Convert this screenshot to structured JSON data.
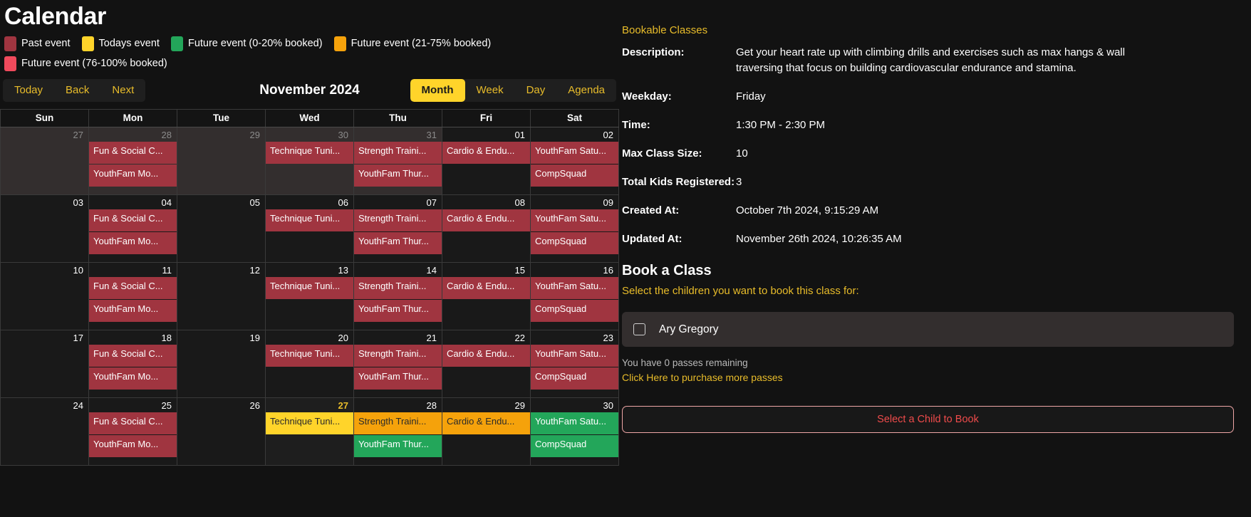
{
  "page": {
    "title": "Calendar"
  },
  "legend": {
    "items": [
      {
        "label": "Past event",
        "color": "#a03540"
      },
      {
        "label": "Todays event",
        "color": "#ffd42a"
      },
      {
        "label": "Future event (0-20% booked)",
        "color": "#23a65a"
      },
      {
        "label": "Future event (21-75% booked)",
        "color": "#f5a20b"
      },
      {
        "label": "Future event (76-100% booked)",
        "color": "#f04a5c"
      }
    ]
  },
  "toolbar": {
    "nav": [
      "Today",
      "Back",
      "Next"
    ],
    "label": "November 2024",
    "views": [
      {
        "label": "Month",
        "active": true
      },
      {
        "label": "Week",
        "active": false
      },
      {
        "label": "Day",
        "active": false
      },
      {
        "label": "Agenda",
        "active": false
      }
    ]
  },
  "calendar": {
    "weekdays": [
      "Sun",
      "Mon",
      "Tue",
      "Wed",
      "Thu",
      "Fri",
      "Sat"
    ],
    "weeks": [
      [
        {
          "num": "27",
          "off": true,
          "today": false,
          "events": []
        },
        {
          "num": "28",
          "off": true,
          "today": false,
          "events": [
            {
              "title": "Fun & Social C...",
              "state": "past"
            },
            {
              "title": "YouthFam Mo...",
              "state": "past"
            }
          ]
        },
        {
          "num": "29",
          "off": true,
          "today": false,
          "events": []
        },
        {
          "num": "30",
          "off": true,
          "today": false,
          "events": [
            {
              "title": "Technique Tuni...",
              "state": "past"
            }
          ]
        },
        {
          "num": "31",
          "off": true,
          "today": false,
          "events": [
            {
              "title": "Strength Traini...",
              "state": "past"
            },
            {
              "title": "YouthFam Thur...",
              "state": "past"
            }
          ]
        },
        {
          "num": "01",
          "off": false,
          "today": false,
          "events": [
            {
              "title": "Cardio & Endu...",
              "state": "past"
            }
          ]
        },
        {
          "num": "02",
          "off": false,
          "today": false,
          "events": [
            {
              "title": "YouthFam Satu...",
              "state": "past"
            },
            {
              "title": "CompSquad",
              "state": "past"
            }
          ]
        }
      ],
      [
        {
          "num": "03",
          "off": false,
          "today": false,
          "events": []
        },
        {
          "num": "04",
          "off": false,
          "today": false,
          "events": [
            {
              "title": "Fun & Social C...",
              "state": "past"
            },
            {
              "title": "YouthFam Mo...",
              "state": "past"
            }
          ]
        },
        {
          "num": "05",
          "off": false,
          "today": false,
          "events": []
        },
        {
          "num": "06",
          "off": false,
          "today": false,
          "events": [
            {
              "title": "Technique Tuni...",
              "state": "past"
            }
          ]
        },
        {
          "num": "07",
          "off": false,
          "today": false,
          "events": [
            {
              "title": "Strength Traini...",
              "state": "past"
            },
            {
              "title": "YouthFam Thur...",
              "state": "past"
            }
          ]
        },
        {
          "num": "08",
          "off": false,
          "today": false,
          "events": [
            {
              "title": "Cardio & Endu...",
              "state": "past"
            }
          ]
        },
        {
          "num": "09",
          "off": false,
          "today": false,
          "events": [
            {
              "title": "YouthFam Satu...",
              "state": "past"
            },
            {
              "title": "CompSquad",
              "state": "past"
            }
          ]
        }
      ],
      [
        {
          "num": "10",
          "off": false,
          "today": false,
          "events": []
        },
        {
          "num": "11",
          "off": false,
          "today": false,
          "events": [
            {
              "title": "Fun & Social C...",
              "state": "past"
            },
            {
              "title": "YouthFam Mo...",
              "state": "past"
            }
          ]
        },
        {
          "num": "12",
          "off": false,
          "today": false,
          "events": []
        },
        {
          "num": "13",
          "off": false,
          "today": false,
          "events": [
            {
              "title": "Technique Tuni...",
              "state": "past"
            }
          ]
        },
        {
          "num": "14",
          "off": false,
          "today": false,
          "events": [
            {
              "title": "Strength Traini...",
              "state": "past"
            },
            {
              "title": "YouthFam Thur...",
              "state": "past"
            }
          ]
        },
        {
          "num": "15",
          "off": false,
          "today": false,
          "events": [
            {
              "title": "Cardio & Endu...",
              "state": "past"
            }
          ]
        },
        {
          "num": "16",
          "off": false,
          "today": false,
          "events": [
            {
              "title": "YouthFam Satu...",
              "state": "past"
            },
            {
              "title": "CompSquad",
              "state": "past"
            }
          ]
        }
      ],
      [
        {
          "num": "17",
          "off": false,
          "today": false,
          "events": []
        },
        {
          "num": "18",
          "off": false,
          "today": false,
          "events": [
            {
              "title": "Fun & Social C...",
              "state": "past"
            },
            {
              "title": "YouthFam Mo...",
              "state": "past"
            }
          ]
        },
        {
          "num": "19",
          "off": false,
          "today": false,
          "events": []
        },
        {
          "num": "20",
          "off": false,
          "today": false,
          "events": [
            {
              "title": "Technique Tuni...",
              "state": "past"
            }
          ]
        },
        {
          "num": "21",
          "off": false,
          "today": false,
          "events": [
            {
              "title": "Strength Traini...",
              "state": "past"
            },
            {
              "title": "YouthFam Thur...",
              "state": "past"
            }
          ]
        },
        {
          "num": "22",
          "off": false,
          "today": false,
          "events": [
            {
              "title": "Cardio & Endu...",
              "state": "past"
            }
          ]
        },
        {
          "num": "23",
          "off": false,
          "today": false,
          "events": [
            {
              "title": "YouthFam Satu...",
              "state": "past"
            },
            {
              "title": "CompSquad",
              "state": "past"
            }
          ]
        }
      ],
      [
        {
          "num": "24",
          "off": false,
          "today": false,
          "events": []
        },
        {
          "num": "25",
          "off": false,
          "today": false,
          "events": [
            {
              "title": "Fun & Social C...",
              "state": "past"
            },
            {
              "title": "YouthFam Mo...",
              "state": "past"
            }
          ]
        },
        {
          "num": "26",
          "off": false,
          "today": false,
          "events": []
        },
        {
          "num": "27",
          "off": false,
          "today": true,
          "events": [
            {
              "title": "Technique Tuni...",
              "state": "today"
            }
          ]
        },
        {
          "num": "28",
          "off": false,
          "today": false,
          "events": [
            {
              "title": "Strength Traini...",
              "state": "mid"
            },
            {
              "title": "YouthFam Thur...",
              "state": "low"
            }
          ]
        },
        {
          "num": "29",
          "off": false,
          "today": false,
          "events": [
            {
              "title": "Cardio & Endu...",
              "state": "mid"
            }
          ]
        },
        {
          "num": "30",
          "off": false,
          "today": false,
          "events": [
            {
              "title": "YouthFam Satu...",
              "state": "low"
            },
            {
              "title": "CompSquad",
              "state": "low"
            }
          ]
        }
      ]
    ]
  },
  "detail": {
    "header_link": "Bookable Classes",
    "fields": [
      {
        "label": "Description:",
        "value": "Get your heart rate up with climbing drills and exercises such as max hangs & wall traversing that focus on building cardiovascular endurance and stamina."
      },
      {
        "label": "Weekday:",
        "value": "Friday"
      },
      {
        "label": "Time:",
        "value": "1:30 PM - 2:30 PM"
      },
      {
        "label": "Max Class Size:",
        "value": "10"
      },
      {
        "label": "Total Kids Registered:",
        "value": "3"
      },
      {
        "label": "Created At:",
        "value": "October 7th 2024, 9:15:29 AM"
      },
      {
        "label": "Updated At:",
        "value": "November 26th 2024, 10:26:35 AM"
      }
    ],
    "book_section": {
      "title": "Book a Class",
      "subtitle": "Select the children you want to book this class for:",
      "children": [
        {
          "name": "Ary Gregory",
          "checked": false
        }
      ],
      "passes_text": "You have 0 passes remaining",
      "passes_link": "Click Here to purchase more passes",
      "book_button": "Select a Child to Book"
    }
  }
}
